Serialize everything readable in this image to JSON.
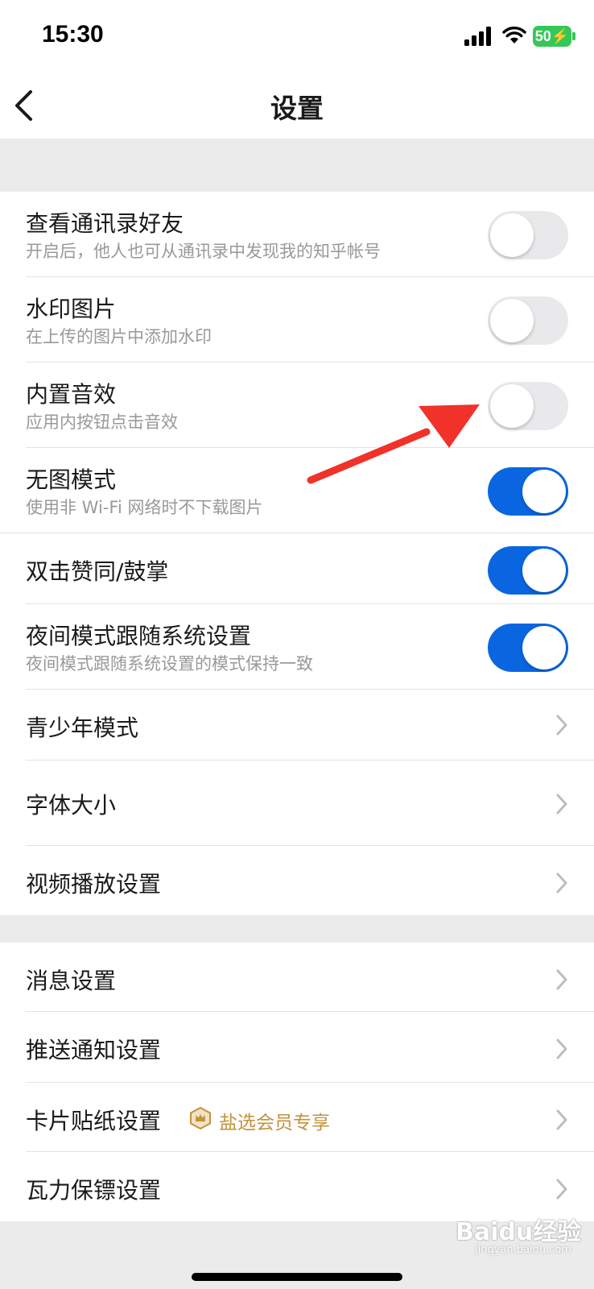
{
  "status_bar": {
    "time": "15:30",
    "battery": "50",
    "battery_color": "#35c759"
  },
  "nav": {
    "title": "设置",
    "back_icon": "chevron-left-icon"
  },
  "group1": [
    {
      "title": "查看通讯录好友",
      "subtitle": "开启后，他人也可从通讯录中发现我的知乎帐号",
      "toggle": "off"
    },
    {
      "title": "水印图片",
      "subtitle": "在上传的图片中添加水印",
      "toggle": "off"
    },
    {
      "title": "内置音效",
      "subtitle": "应用内按钮点击音效",
      "toggle": "off"
    },
    {
      "title": "无图模式",
      "subtitle": "使用非 Wi-Fi 网络时不下载图片",
      "toggle": "on"
    },
    {
      "title": "双击赞同/鼓掌",
      "toggle": "on"
    },
    {
      "title": "夜间模式跟随系统设置",
      "subtitle": "夜间模式跟随系统设置的模式保持一致",
      "toggle": "on"
    },
    {
      "title": "青少年模式"
    },
    {
      "title": "字体大小"
    },
    {
      "title": "视频播放设置"
    }
  ],
  "group2": [
    {
      "title": "消息设置"
    },
    {
      "title": "推送通知设置"
    },
    {
      "title": "卡片贴纸设置",
      "badge": "盐选会员专享"
    },
    {
      "title": "瓦力保镖设置"
    }
  ],
  "colors": {
    "toggle_on": "#0a66e0",
    "toggle_off": "#e9e9eb",
    "badge": "#c2923d",
    "annotation_arrow": "#f0322a"
  },
  "watermark": {
    "text": "Baidu经验",
    "sub": "jingyan.baidu.com"
  }
}
